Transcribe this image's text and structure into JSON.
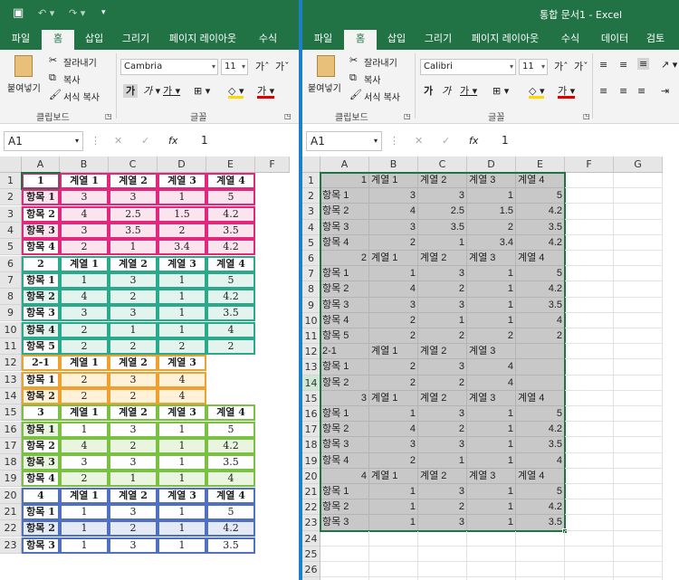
{
  "window_title": "통합 문서1  -  Excel",
  "tabs_left": [
    "파일",
    "홈",
    "삽입",
    "그리기",
    "페이지 레이아웃",
    "수식"
  ],
  "tabs_right": [
    "파일",
    "홈",
    "삽입",
    "그리기",
    "페이지 레이아웃",
    "수식",
    "데이터",
    "검토"
  ],
  "ribbon": {
    "paste": "붙여넣기",
    "cut": "잘라내기",
    "copy": "복사",
    "format_painter": "서식 복사",
    "clipboard": "클립보드",
    "font_group": "글꼴",
    "font_left": "Cambria",
    "font_right": "Calibri",
    "size": "11"
  },
  "namebox": "A1",
  "fx": "fx",
  "formula_value": "1",
  "colors": {
    "pink": "#e0297c",
    "teal": "#2aaa8a",
    "orange": "#f0a030",
    "green": "#7ac143",
    "blue": "#5070c0",
    "pinkfill": "#fbe4ee",
    "tealfill": "#e3f4ef",
    "orangefill": "#fff2d9",
    "greenfill": "#eaf5e0",
    "bluefill": "#e4e9f6",
    "excel_green": "#217346"
  },
  "left_columns": [
    "A",
    "B",
    "C",
    "D",
    "E",
    "F"
  ],
  "right_columns": [
    "A",
    "B",
    "C",
    "D",
    "E",
    "F",
    "G"
  ],
  "rows": [
    [
      "1",
      "계열 1",
      "계열 2",
      "계열 3",
      "계열 4"
    ],
    [
      "항목 1",
      "3",
      "3",
      "1",
      "5"
    ],
    [
      "항목 2",
      "4",
      "2.5",
      "1.5",
      "4.2"
    ],
    [
      "항목 3",
      "3",
      "3.5",
      "2",
      "3.5"
    ],
    [
      "항목 4",
      "2",
      "1",
      "3.4",
      "4.2"
    ],
    [
      "2",
      "계열 1",
      "계열 2",
      "계열 3",
      "계열 4"
    ],
    [
      "항목 1",
      "1",
      "3",
      "1",
      "5"
    ],
    [
      "항목 2",
      "4",
      "2",
      "1",
      "4.2"
    ],
    [
      "항목 3",
      "3",
      "3",
      "1",
      "3.5"
    ],
    [
      "항목 4",
      "2",
      "1",
      "1",
      "4"
    ],
    [
      "항목 5",
      "2",
      "2",
      "2",
      "2"
    ],
    [
      "2-1",
      "계열 1",
      "계열 2",
      "계열 3",
      ""
    ],
    [
      "항목 1",
      "2",
      "3",
      "4",
      ""
    ],
    [
      "항목 2",
      "2",
      "2",
      "4",
      ""
    ],
    [
      "3",
      "계열 1",
      "계열 2",
      "계열 3",
      "계열 4"
    ],
    [
      "항목 1",
      "1",
      "3",
      "1",
      "5"
    ],
    [
      "항목 2",
      "4",
      "2",
      "1",
      "4.2"
    ],
    [
      "항목 3",
      "3",
      "3",
      "1",
      "3.5"
    ],
    [
      "항목 4",
      "2",
      "1",
      "1",
      "4"
    ],
    [
      "4",
      "계열 1",
      "계열 2",
      "계열 3",
      "계열 4"
    ],
    [
      "항목 1",
      "1",
      "3",
      "1",
      "5"
    ],
    [
      "항목 2",
      "1",
      "2",
      "1",
      "4.2"
    ],
    [
      "항목 3",
      "1",
      "3",
      "1",
      "3.5"
    ]
  ],
  "left_row_count": 23,
  "right_row_count": 27
}
